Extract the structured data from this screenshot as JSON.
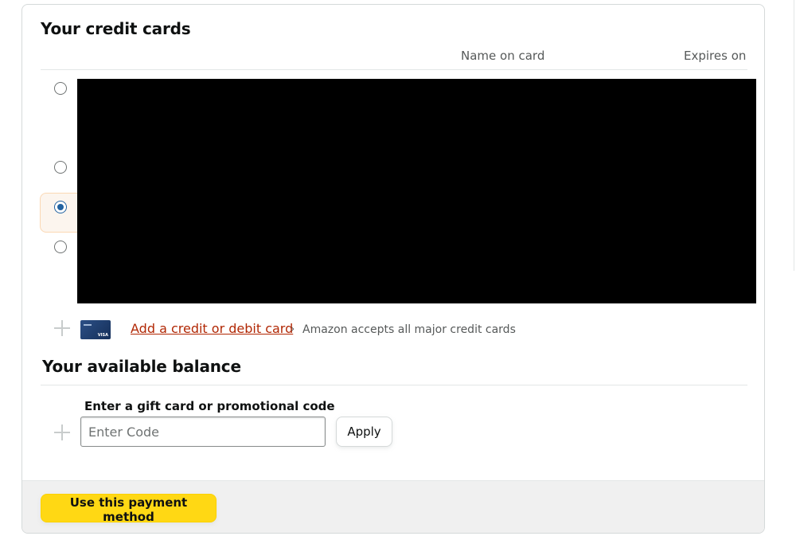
{
  "credit_cards": {
    "title": "Your credit cards",
    "columns": {
      "name": "Name on card",
      "expires": "Expires on"
    },
    "options": [
      {
        "selected": false
      },
      {
        "selected": false
      },
      {
        "selected": true
      },
      {
        "selected": false
      }
    ],
    "add_card": {
      "link_label": "Add a credit or debit card",
      "chevron": "›",
      "note": "Amazon accepts all major credit cards"
    }
  },
  "balance": {
    "title": "Your available balance",
    "code_label": "Enter a gift card or promotional code",
    "code_placeholder": "Enter Code",
    "apply_label": "Apply"
  },
  "footer": {
    "use_button_label": "Use this payment method"
  },
  "colors": {
    "link": "#b12704",
    "primary_button": "#ffd814",
    "selected_row_bg": "#fcf5ee",
    "radio_checked": "#2162a1"
  }
}
